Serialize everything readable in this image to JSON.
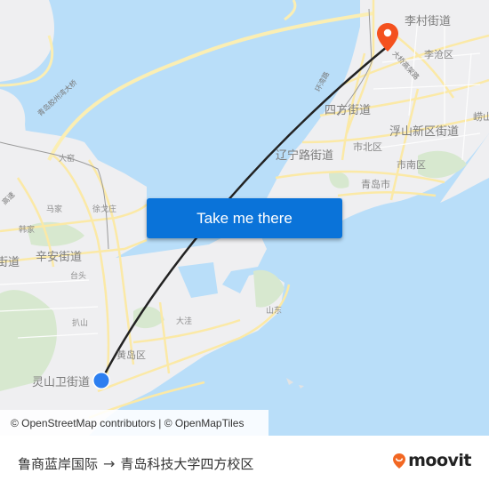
{
  "map": {
    "labels": {
      "licun": "李村街道",
      "licang": "李沧区",
      "sifang": "四方街道",
      "fushan": "浮山新区街道",
      "lao": "崂山",
      "liaoning": "辽宁路街道",
      "shibei": "市北区",
      "shinan": "市南区",
      "qingdao": "青岛市",
      "xinan": "辛安街道",
      "jiedao_partial": "街道",
      "majia": "马家",
      "hanjia": "韩家",
      "xugezhuang": "徐戈庄",
      "dayao": "大窑",
      "taitou": "台头",
      "bashan": "扒山",
      "huangdao": "黄岛区",
      "lingshanwei": "灵山卫街道",
      "shandong": "山东",
      "dazhu": "大洼",
      "bridge_road": "青岛胶州湾大桥",
      "highway_road": "环湾路",
      "elevated_road": "大桥高架路",
      "gaosu": "高速"
    },
    "origin_marker": {
      "label": "origin",
      "color": "#2d7ff0"
    },
    "destination_marker": {
      "label": "destination",
      "color": "#f4511e"
    },
    "route_line_color": "#222222"
  },
  "cta": {
    "label": "Take me there",
    "color": "#0a73d9"
  },
  "attribution": {
    "text": "© OpenStreetMap contributors | © OpenMapTiles"
  },
  "footer": {
    "origin": "鲁商蓝岸国际",
    "arrow": "→",
    "destination": "青岛科技大学四方校区",
    "brand": "moovit",
    "brand_color": "#f26722"
  }
}
